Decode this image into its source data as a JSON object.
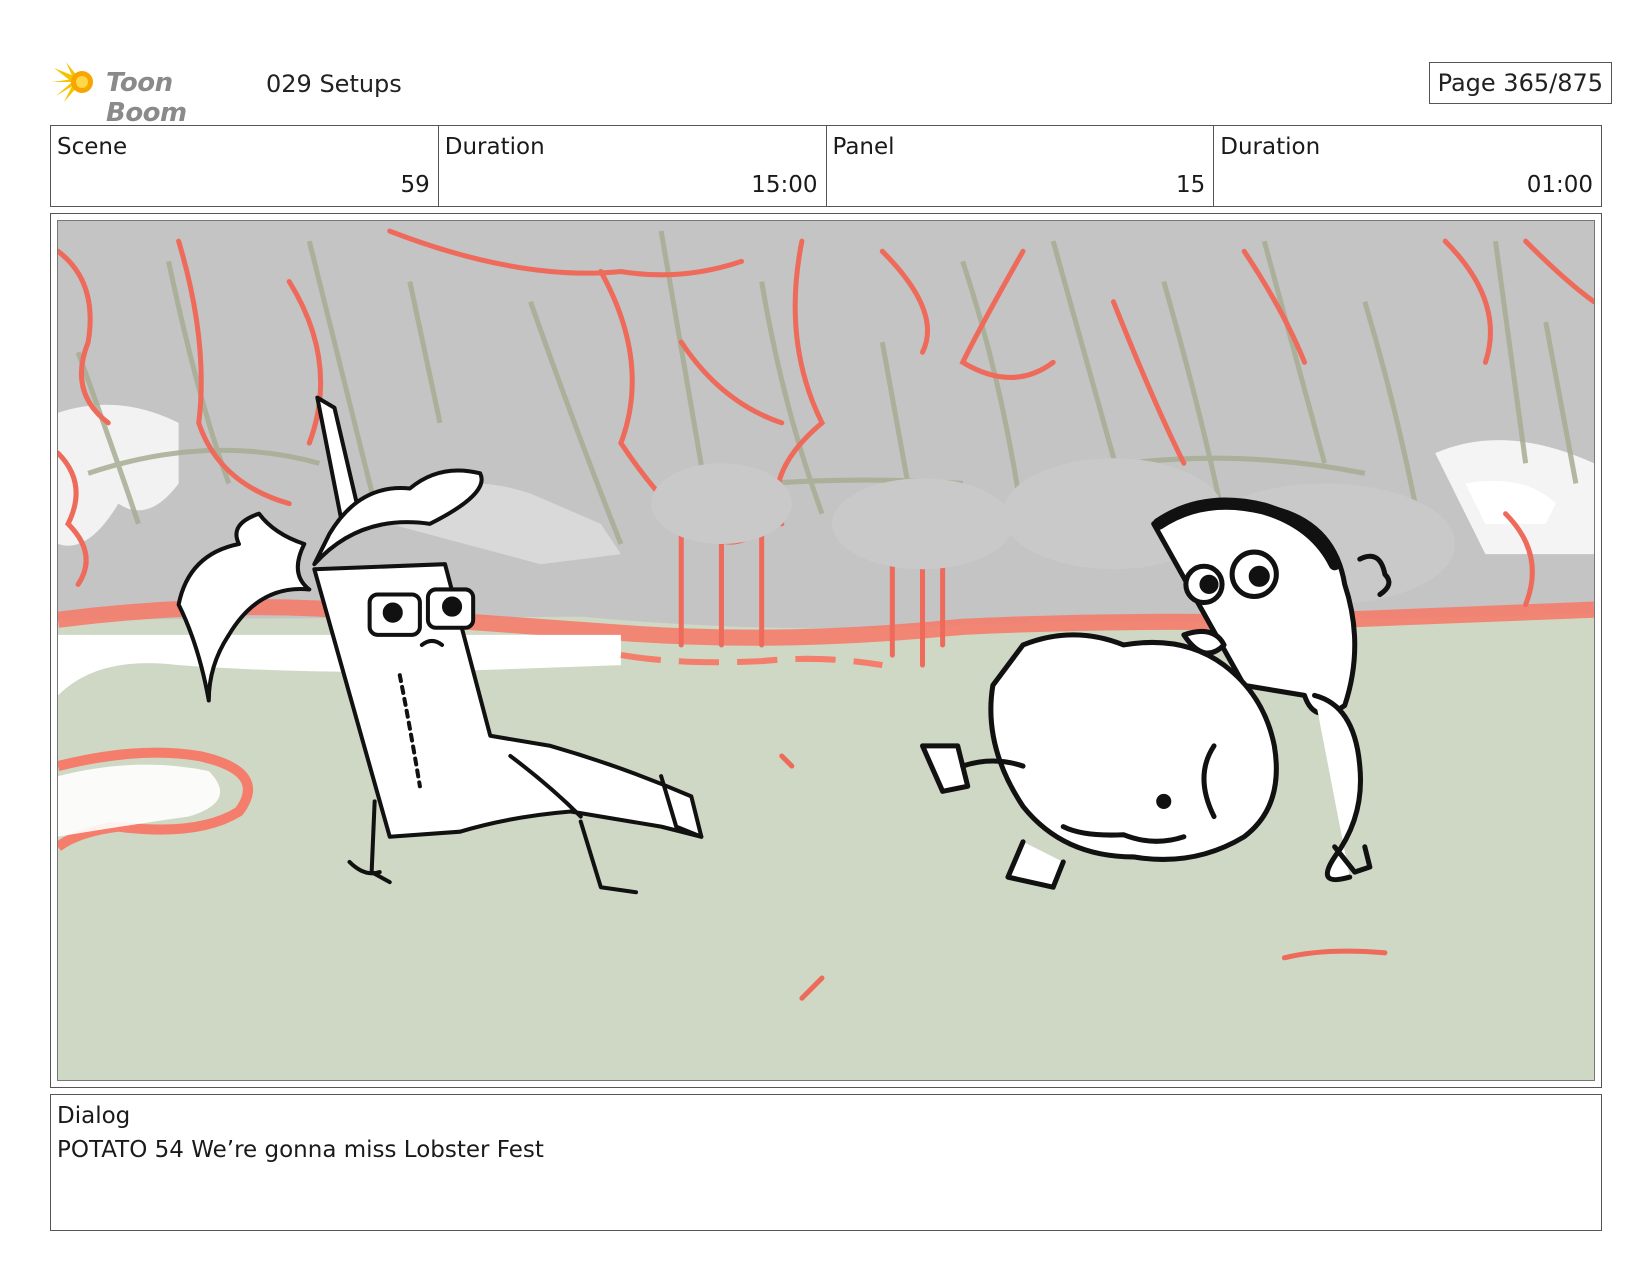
{
  "header": {
    "logo_text": "Toon Boom",
    "project_title": "029 Setups",
    "page": "Page 365/875"
  },
  "info": {
    "scene_label": "Scene",
    "scene_value": "59",
    "scene_duration_label": "Duration",
    "scene_duration_value": "15:00",
    "panel_label": "Panel",
    "panel_value": "15",
    "panel_duration_label": "Duration",
    "panel_duration_value": "01:00"
  },
  "dialog": {
    "label": "Dialog",
    "text": "POTATO 54 We’re gonna miss Lobster Fest"
  },
  "colors": {
    "ground": "#cfd8c4",
    "sky_grey": "#c4c4c4",
    "red_lines": "#ee6b5c",
    "olive_lines": "#a7ad93",
    "logo_flare": "#f5c400"
  }
}
